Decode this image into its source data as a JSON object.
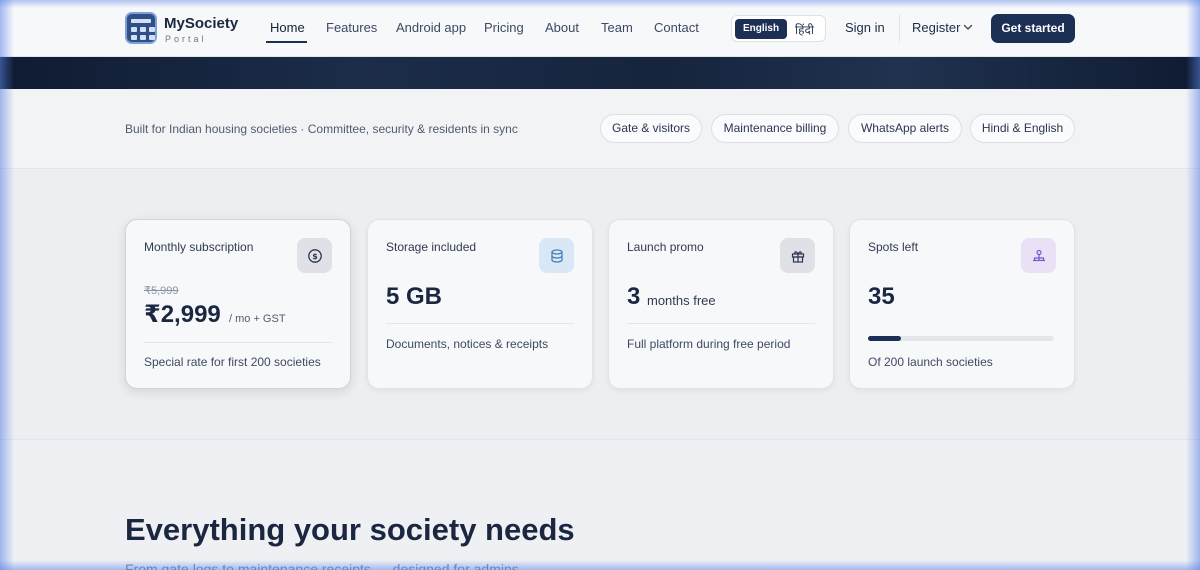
{
  "brand": {
    "name": "MySociety",
    "subtitle": "Portal"
  },
  "nav": {
    "items": [
      {
        "label": "Home",
        "active": true
      },
      {
        "label": "Features"
      },
      {
        "label": "Android app"
      },
      {
        "label": "Pricing"
      },
      {
        "label": "About"
      },
      {
        "label": "Team"
      },
      {
        "label": "Contact"
      }
    ],
    "languages": {
      "english": "English",
      "hindi": "हिंदी",
      "selected": "English"
    },
    "sign_in": "Sign in",
    "register": "Register",
    "get_started": "Get started"
  },
  "info": {
    "tagline": "Built for Indian housing societies · Committee, security & residents in sync",
    "chips": [
      "Gate & visitors",
      "Maintenance billing",
      "WhatsApp alerts",
      "Hindi & English"
    ]
  },
  "stats": {
    "subscription": {
      "title": "Monthly subscription",
      "old_price": "₹5,999",
      "price": "₹2,999",
      "unit": "/ mo + GST",
      "note": "Special rate for first 200 societies",
      "icon": "dollar-circle-icon"
    },
    "storage": {
      "title": "Storage included",
      "value": "5 GB",
      "note": "Documents, notices & receipts",
      "icon": "database-icon"
    },
    "promo": {
      "title": "Launch promo",
      "value": "3",
      "unit": "months free",
      "note": "Full platform during free period",
      "icon": "gift-icon"
    },
    "spots": {
      "title": "Spots left",
      "value": "35",
      "progress": 0.175,
      "note": "Of 200 launch societies",
      "icon": "users-network-icon"
    }
  },
  "colors": {
    "primary": "#1c2f55",
    "icon_bg_subscription": "#dfe1e6",
    "icon_bg_storage": "#d9e8f6",
    "icon_bg_promo": "#dfe1e6",
    "icon_bg_spots": "#e9e2f7"
  },
  "section": {
    "title": "Everything your society needs",
    "subtitle": "From gate logs to maintenance receipts — designed for admins"
  }
}
